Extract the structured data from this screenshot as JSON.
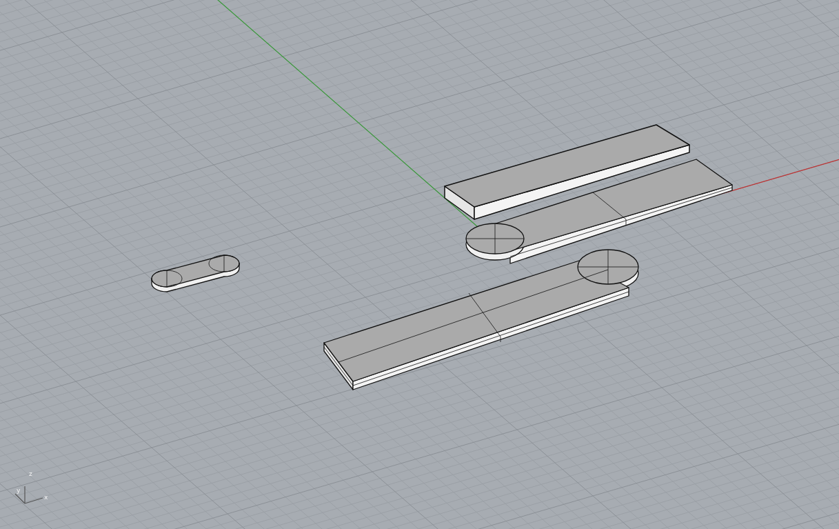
{
  "viewport": {
    "axis_labels": [
      "x",
      "y",
      "z"
    ]
  }
}
